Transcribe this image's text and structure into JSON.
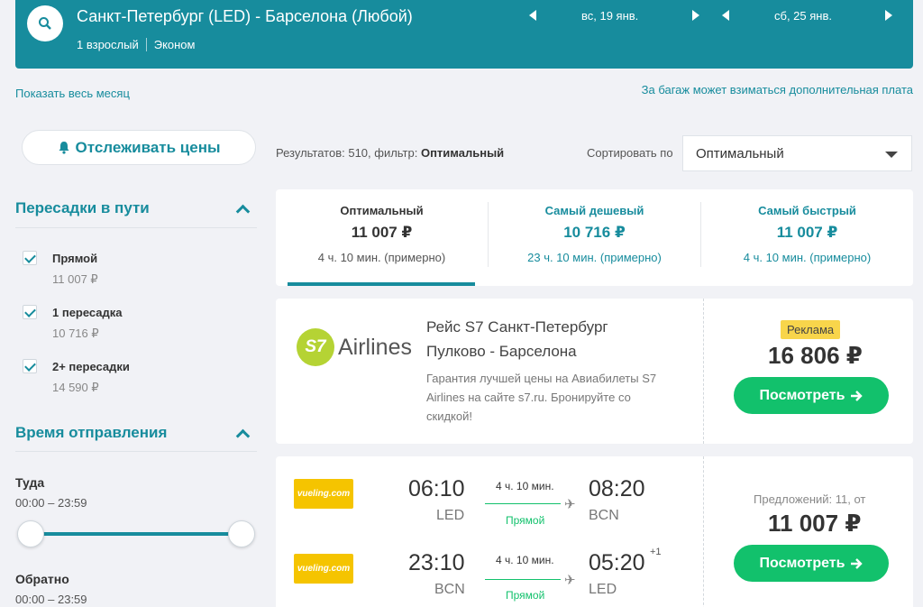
{
  "header": {
    "route": "Санкт-Петербург (LED) - Барселона (Любой)",
    "passengers": "1 взрослый",
    "cabin": "Эконом",
    "depart_date": "вс, 19 янв.",
    "return_date": "сб, 25 янв."
  },
  "links": {
    "show_month": "Показать весь месяц",
    "baggage_note": "За багаж может взиматься дополнительная плата"
  },
  "sidebar": {
    "track_label": "Отслеживать цены",
    "stops_title": "Пересадки в пути",
    "stops": [
      {
        "label": "Прямой",
        "price": "11 007 ₽"
      },
      {
        "label": "1 пересадка",
        "price": "10 716 ₽"
      },
      {
        "label": "2+ пересадки",
        "price": "14 590 ₽"
      }
    ],
    "departure_title": "Время отправления",
    "outbound_label": "Туда",
    "outbound_range": "00:00 – 23:59",
    "return_label": "Обратно",
    "return_range": "00:00 – 23:59"
  },
  "results": {
    "prefix": "Результатов: 510, фильтр: ",
    "filter": "Оптимальный",
    "sort_label": "Сортировать по",
    "sort_value": "Оптимальный"
  },
  "tabs": [
    {
      "title": "Оптимальный",
      "price": "11 007 ₽",
      "duration": "4 ч. 10 мин. (примерно)"
    },
    {
      "title": "Самый дешевый",
      "price": "10 716 ₽",
      "duration": "23 ч. 10 мин. (примерно)"
    },
    {
      "title": "Самый быстрый",
      "price": "11 007 ₽",
      "duration": "4 ч. 10 мин. (примерно)"
    }
  ],
  "ad": {
    "logo_s7": "S7",
    "logo_text": "Airlines",
    "title_line1": "Рейс S7 Санкт-Петербург",
    "title_line2": "Пулково - Барселона",
    "desc1": "Гарантия лучшей цены на Авиабилеты S7",
    "desc2": "Airlines на сайте s7.ru. Бронируйте со",
    "desc3": "скидкой!",
    "badge": "Реклама",
    "price": "16 806 ₽",
    "button": "Посмотреть"
  },
  "flight": {
    "airline_logo": "vueling.com",
    "offers": "Предложений: 11, от",
    "price": "11 007 ₽",
    "button": "Посмотреть",
    "outbound": {
      "dep_time": "06:10",
      "dep_iata": "LED",
      "duration": "4 ч. 10 мин.",
      "stops": "Прямой",
      "arr_time": "08:20",
      "arr_iata": "BCN"
    },
    "inbound": {
      "dep_time": "23:10",
      "dep_iata": "BCN",
      "duration": "4 ч. 10 мин.",
      "stops": "Прямой",
      "arr_time": "05:20",
      "arr_plus": "+1",
      "arr_iata": "LED"
    }
  },
  "colors": {
    "accent": "#178c9d",
    "green": "#12c16c",
    "ad_badge": "#f8d54b",
    "s7_green": "#b5d334",
    "vueling_yellow": "#f5c400"
  }
}
